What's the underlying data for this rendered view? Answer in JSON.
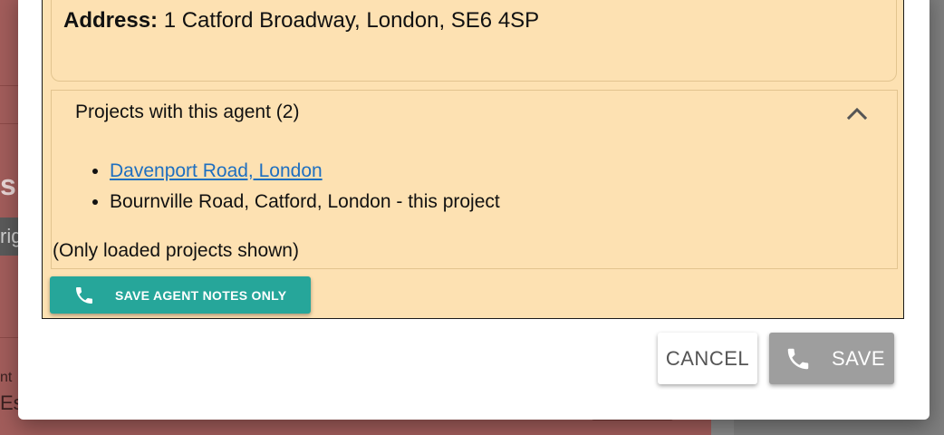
{
  "background": {
    "partial_heading": "s",
    "partial_chip": "rig",
    "partial_label": "nt",
    "partial_value": "Es"
  },
  "agent": {
    "address_label": "Address:",
    "address_value": "1 Catford Broadway, London, SE6 4SP"
  },
  "projects": {
    "header": "Projects with this agent (2)",
    "items": [
      {
        "label": "Davenport Road, London",
        "is_link": true
      },
      {
        "label": "Bournville Road, Catford, London - this project",
        "is_link": false
      }
    ],
    "note": "(Only loaded projects shown)"
  },
  "buttons": {
    "save_notes": "SAVE AGENT NOTES ONLY",
    "cancel": "CANCEL",
    "save": "SAVE"
  },
  "icons": {
    "phone": "phone-icon",
    "chevron": "chevron-up-icon"
  },
  "colors": {
    "panel_background": "#fde1b2",
    "primary_teal": "#26a69a",
    "disabled_gray": "#9e9e9e",
    "link_blue": "#1e6fc0"
  }
}
